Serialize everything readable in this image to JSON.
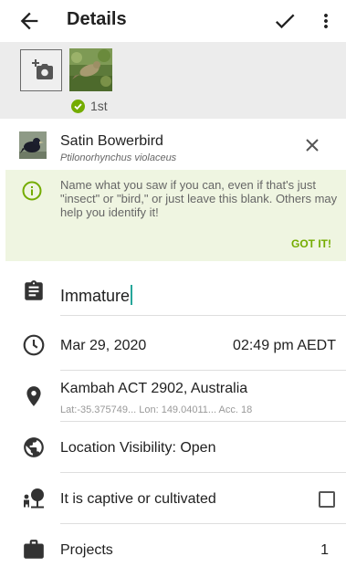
{
  "toolbar": {
    "title": "Details",
    "back_icon": "arrow-back-icon",
    "confirm_icon": "check-icon",
    "menu_icon": "more-vert-icon"
  },
  "photos": {
    "add_icon": "add-photo-icon",
    "badge": "1st",
    "badge_color": "#74ac00"
  },
  "species": {
    "common_name": "Satin Bowerbird",
    "scientific_name": "Ptilonorhynchus violaceus"
  },
  "tip": {
    "text": "Name what you saw if you can, even if that's just \"insect\" or \"bird,\" or just leave this blank. Others may help you identify it!",
    "action": "GOT IT!",
    "accent": "#74ac00",
    "background": "#eff5e1"
  },
  "notes": {
    "value": "Immature",
    "icon": "clipboard-icon"
  },
  "datetime": {
    "date": "Mar 29, 2020",
    "time": "02:49 pm AEDT",
    "icon": "clock-icon"
  },
  "location": {
    "place": "Kambah ACT 2902, Australia",
    "coords": "Lat:-35.375749...  Lon: 149.04011...  Acc. 18",
    "icon": "location-pin-icon"
  },
  "visibility": {
    "label": "Location Visibility: Open",
    "icon": "globe-icon"
  },
  "captive": {
    "label": "It is captive or cultivated",
    "checked": false,
    "icon": "plant-person-icon"
  },
  "projects": {
    "label": "Projects",
    "count": "1",
    "icon": "briefcase-icon"
  }
}
